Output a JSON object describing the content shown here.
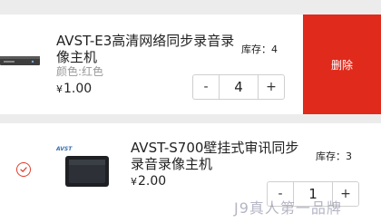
{
  "cart": {
    "items": [
      {
        "title": "AVST-E3高清网络同步录音录像主机",
        "variant": "颜色:红色",
        "currency": "¥",
        "price": "1.00",
        "stock": "库存：4",
        "quantity": "4",
        "minus": "-",
        "plus": "+",
        "delete_label": "删除"
      },
      {
        "title": "AVST-S700壁挂式审讯同步录音录像主机",
        "currency": "¥",
        "price": "2.00",
        "stock": "库存：3",
        "quantity": "1",
        "minus": "-",
        "plus": "+",
        "selected": true
      }
    ]
  },
  "watermark": "J9真人第一品牌",
  "colors": {
    "delete_bg": "#e02a1c",
    "check_accent": "#e23b2a",
    "page_bg": "#ececec"
  },
  "icons": {
    "item1_image": "device-thumbnail-icon",
    "item2_image": "device-thumbnail-icon",
    "item2_check": "checked-circle-icon"
  }
}
